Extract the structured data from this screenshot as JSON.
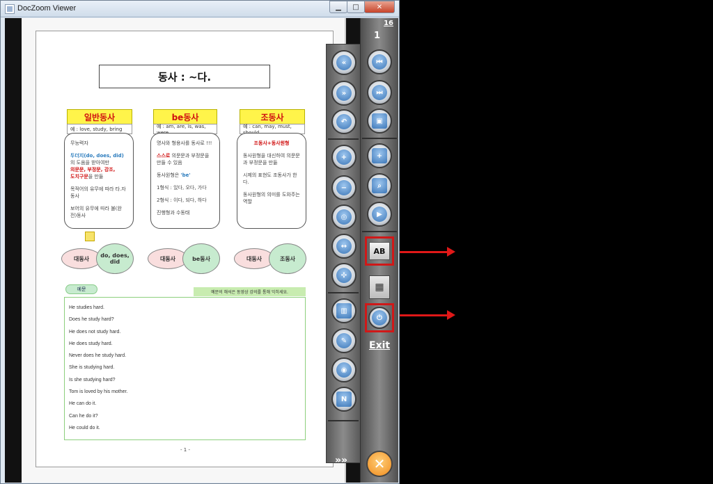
{
  "window": {
    "title": "DocZoom Viewer",
    "minimize": "▁",
    "maximize": "□",
    "close": "✕"
  },
  "document": {
    "title": "동사 : ~다.",
    "categories": [
      {
        "name": "일반동사",
        "example": "예 : love, study, bring"
      },
      {
        "name": "be동사",
        "example": "예 : am, are, is, was, were"
      },
      {
        "name": "조동사",
        "example": "예 : can, may, must, should"
      }
    ],
    "card1": {
      "p1": "무능력자",
      "p2a": "두더지(do, does, did)",
      "p2b": "의 도움을 받아여만",
      "p2c": "의문문, 부정문, 강조,",
      "p2d": "도치구문",
      "p2e": "을 만듦",
      "p3": "목적어의 유무에 따라 타.자동사",
      "p4": "보어의 유무에 따라 불(완전)동사"
    },
    "card2": {
      "p1": "명사와 형용사를 동사로 !!!",
      "p2a": "스스로",
      "p2b": " 의문문과 부정문을 만들 수 있음",
      "p3a": "동사원형은 ",
      "p3b": "'be'",
      "p4": "1형식 : 있다, 오다, 가다",
      "p5": "2형식 : 이다, 되다, 하다",
      "p6": "진행형과 수동태"
    },
    "card3": {
      "p1": "조동사+동사원형",
      "p2": "동사원형을 대신하여 의문문과 부정문을 만듦",
      "p3": "시제의 표현도 조동사가 한다.",
      "p4": "동사원형의 의미를 도와주는 역할"
    },
    "pairs": [
      {
        "left": "대동사",
        "right": "do, does, did"
      },
      {
        "left": "대동사",
        "right": "be동사"
      },
      {
        "left": "대동사",
        "right": "조동사"
      }
    ],
    "example_tag": "예문",
    "example_note": "예문의 해석은 동영상 강의를 통해 익히세요.",
    "examples": [
      "He studies hard.",
      "Does he study hard?",
      "He does not study hard.",
      "He does study hard.",
      "Never does he study hard.",
      "She is studying hard.",
      "Is she studying hard?",
      "Tom is loved by his mother.",
      "He can do it.",
      "Can he do it?",
      "He could do it."
    ],
    "page_number": "- 1 -"
  },
  "toolbar_right": {
    "total_pages": "16",
    "current_page": "1",
    "ab_label": "AB",
    "exit_label": "Exit",
    "more_label": "»»",
    "quit_label": "✕"
  },
  "colors": {
    "highlight_border": "#d01818",
    "category_bg": "#fff44a",
    "example_border": "#8ccf7c"
  }
}
